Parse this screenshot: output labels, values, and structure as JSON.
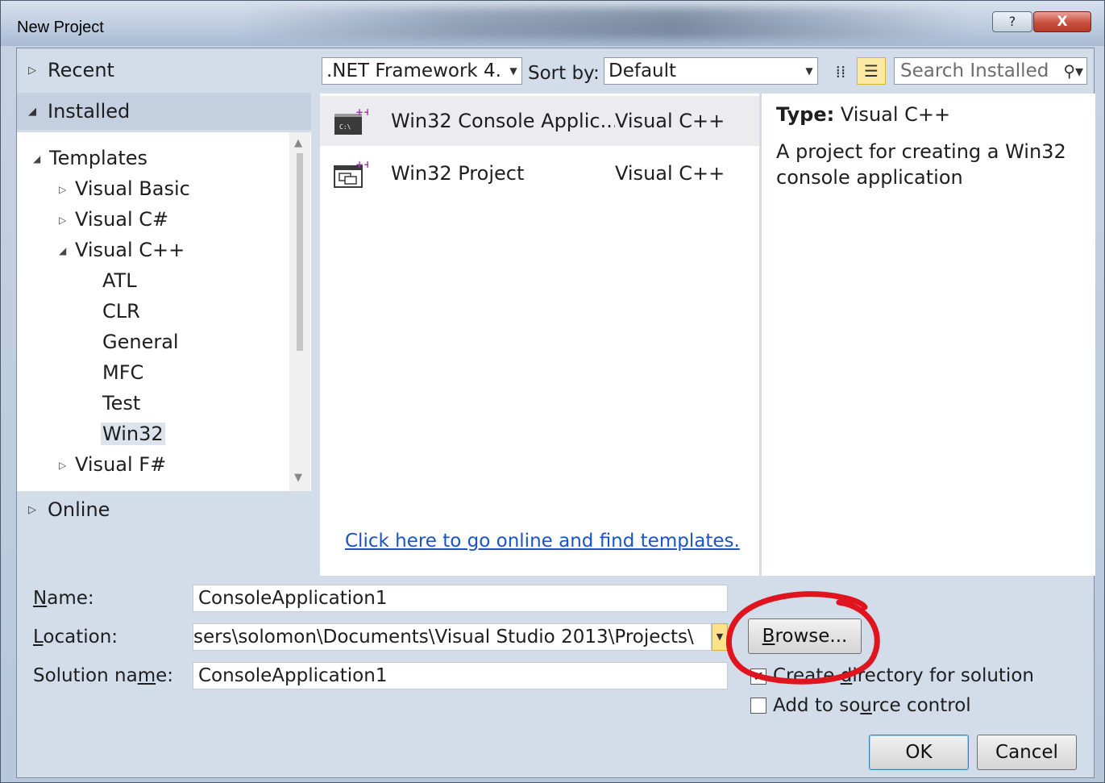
{
  "window": {
    "title": "New Project",
    "help_glyph": "?",
    "close_glyph": "X"
  },
  "nav": {
    "recent": "Recent",
    "installed": "Installed",
    "online": "Online",
    "tree": [
      {
        "label": "Templates",
        "expanded": true,
        "level": 0
      },
      {
        "label": "Visual Basic",
        "expanded": false,
        "level": 1
      },
      {
        "label": "Visual C#",
        "expanded": false,
        "level": 1
      },
      {
        "label": "Visual C++",
        "expanded": true,
        "level": 1
      },
      {
        "label": "ATL",
        "level": 2
      },
      {
        "label": "CLR",
        "level": 2
      },
      {
        "label": "General",
        "level": 2
      },
      {
        "label": "MFC",
        "level": 2
      },
      {
        "label": "Test",
        "level": 2
      },
      {
        "label": "Win32",
        "level": 2,
        "selected": true
      },
      {
        "label": "Visual F#",
        "expanded": false,
        "level": 1
      }
    ]
  },
  "toolbar": {
    "framework": ".NET Framework 4.",
    "sort_by_label": "Sort by:",
    "sort_value": "Default",
    "search_placeholder": "Search Installed"
  },
  "templates": [
    {
      "name": "Win32 Console Applic...",
      "language": "Visual C++",
      "icon": "console-app-icon",
      "selected": true
    },
    {
      "name": "Win32 Project",
      "language": "Visual C++",
      "icon": "win32-project-icon",
      "selected": false
    }
  ],
  "online_link": "Click here to go online and find templates.",
  "details": {
    "type_label": "Type:",
    "type_value": "Visual C++",
    "description": "A project for creating a Win32 console application"
  },
  "form": {
    "name_label": "Name:",
    "name_value": "ConsoleApplication1",
    "location_label": "Location:",
    "location_value": "sers\\solomon\\Documents\\Visual Studio 2013\\Projects\\",
    "solution_label": "Solution name:",
    "solution_value": "ConsoleApplication1",
    "browse_label": "Browse...",
    "create_directory_label": "Create directory for solution",
    "create_directory_checked": true,
    "source_control_label": "Add to source control",
    "source_control_checked": false,
    "ok_label": "OK",
    "cancel_label": "Cancel"
  },
  "colors": {
    "annotation": "#e0141e",
    "link": "#1a54c5",
    "selection": "#ececef"
  }
}
